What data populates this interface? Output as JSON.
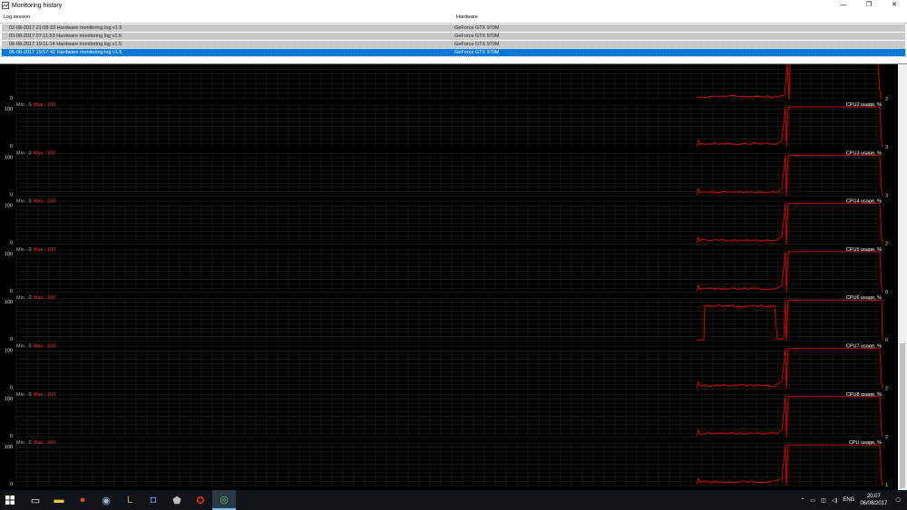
{
  "window": {
    "title": "Monitoring history",
    "min_glyph": "—",
    "max_glyph": "❐",
    "close_glyph": "✕"
  },
  "log_table": {
    "columns": [
      "Log session",
      "Hardware"
    ],
    "rows": [
      {
        "session": "02-08-2017 21:08:33 Hardware monitoring log v1.5",
        "hardware": "GeForce GTX 970M",
        "selected": false
      },
      {
        "session": "03-08-2017 07:11:53 Hardware monitoring log v1.5",
        "hardware": "GeForce GTX 970M",
        "selected": false
      },
      {
        "session": "06-08-2017 19:11:14 Hardware monitoring log v1.5",
        "hardware": "GeForce GTX 970M",
        "selected": false
      },
      {
        "session": "06-08-2017 19:57:42 Hardware monitoring log v1.5",
        "hardware": "GeForce GTX 970M",
        "selected": true
      }
    ]
  },
  "graphs": {
    "grid_color": "#2a2a2a",
    "line_color": "#ff0000",
    "min_label": "Min : 0",
    "max_label": "Max : 100",
    "y_top": "100",
    "y_bottom": "0",
    "first_value": "2",
    "panels": [
      {
        "name": "CPU2 usage, %",
        "value": "3",
        "profile": "low"
      },
      {
        "name": "CPU3 usage, %",
        "value": "3",
        "profile": "low"
      },
      {
        "name": "CPU4 usage, %",
        "value": "2",
        "profile": "low"
      },
      {
        "name": "CPU5 usage, %",
        "value": "0",
        "profile": "low"
      },
      {
        "name": "CPU6 usage, %",
        "value": "0",
        "profile": "high"
      },
      {
        "name": "CPU7 usage, %",
        "value": "2",
        "profile": "low"
      },
      {
        "name": "CPU8 usage, %",
        "value": "2",
        "profile": "low"
      },
      {
        "name": "CPU usage, %",
        "value": "1",
        "profile": "low"
      }
    ]
  },
  "taskbar": {
    "start_icon": "windows-start-icon",
    "apps": [
      {
        "icon": "task-view-icon",
        "glyph": "▭",
        "active": false
      },
      {
        "icon": "file-explorer-icon",
        "glyph": "▬",
        "active": false,
        "color": "#f6c343"
      },
      {
        "icon": "chrome-icon",
        "glyph": "●",
        "active": false,
        "color": "#e8453c"
      },
      {
        "icon": "steam-icon",
        "glyph": "◉",
        "active": false,
        "color": "#9bb5d6"
      },
      {
        "icon": "league-icon",
        "glyph": "L",
        "active": false,
        "color": "#c8a85a"
      },
      {
        "icon": "discord-icon",
        "glyph": "◘",
        "active": false,
        "color": "#7289da"
      },
      {
        "icon": "shield-icon",
        "glyph": "⬟",
        "active": false,
        "color": "#bbbbbb"
      },
      {
        "icon": "msi-afterburner-icon",
        "glyph": "✪",
        "active": false,
        "color": "#e03020"
      },
      {
        "icon": "monitoring-app-icon",
        "glyph": "◎",
        "active": true,
        "color": "#5fbf5f"
      }
    ],
    "language": "ENG",
    "time": "20:07",
    "date": "06/08/2017"
  }
}
